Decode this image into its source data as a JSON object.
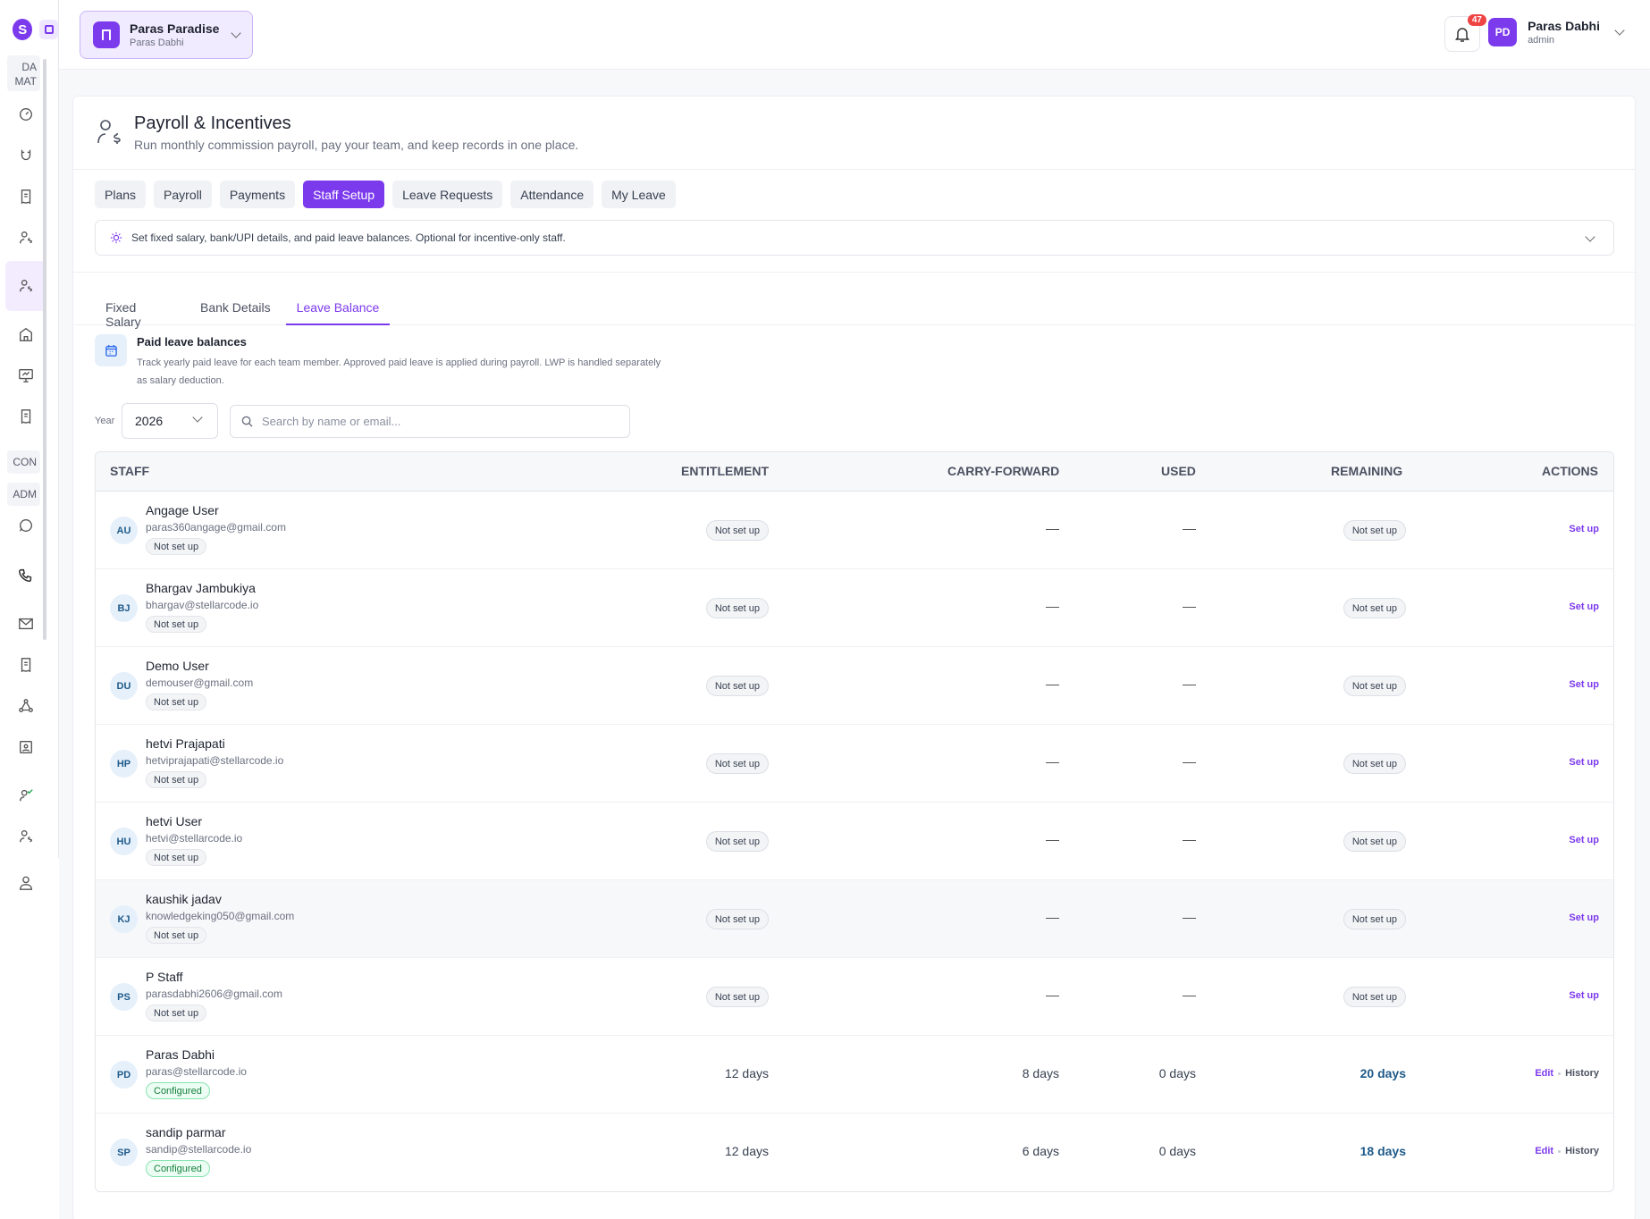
{
  "app": {
    "logo_letter": "S"
  },
  "sidebar": {
    "sections": [
      "DA MAT",
      "CON",
      "ADM"
    ],
    "icons": [
      "dashboard-icon",
      "magnet-icon",
      "receipt-icon",
      "payroll-icon",
      "payroll-active-icon",
      "building-icon",
      "monitor-icon",
      "document-icon",
      "whatsapp-icon",
      "phone-icon",
      "mail-icon",
      "invoice-icon",
      "network-icon",
      "contacts-icon",
      "user-check-icon",
      "user-dollar-icon",
      "profile-icon"
    ]
  },
  "header": {
    "workspace": {
      "name": "Paras Paradise",
      "owner": "Paras Dabhi"
    },
    "notifications": {
      "count": "47"
    },
    "user": {
      "initials": "PD",
      "name": "Paras Dabhi",
      "role": "admin"
    }
  },
  "page": {
    "title": "Payroll & Incentives",
    "subtitle": "Run monthly commission payroll, pay your team, and keep records in one place.",
    "tabs": [
      "Plans",
      "Payroll",
      "Payments",
      "Staff Setup",
      "Leave Requests",
      "Attendance",
      "My Leave"
    ],
    "active_tab": "Staff Setup",
    "hint": "Set fixed salary, bank/UPI details, and paid leave balances. Optional for incentive-only staff.",
    "subtabs": [
      "Fixed Salary",
      "Bank Details",
      "Leave Balance"
    ],
    "active_subtab": "Leave Balance"
  },
  "leave_balance": {
    "title": "Paid leave balances",
    "description": "Track yearly paid leave for each team member. Approved paid leave is applied during payroll. LWP is handled separately as salary deduction.",
    "year_label": "Year",
    "year_value": "2026",
    "search_placeholder": "Search by name or email..."
  },
  "table": {
    "headers": {
      "staff": "STAFF",
      "entitlement": "ENTITLEMENT",
      "carry": "CARRY-FORWARD",
      "used": "USED",
      "remaining": "REMAINING",
      "actions": "ACTIONS"
    },
    "rows": [
      {
        "initials": "AU",
        "name": "Angage User",
        "email": "paras360angage@gmail.com",
        "status": "Not set up",
        "entitlement": "Not set up",
        "carry": "—",
        "used": "—",
        "remaining": "Not set up",
        "action": "Set up"
      },
      {
        "initials": "BJ",
        "name": "Bhargav Jambukiya",
        "email": "bhargav@stellarcode.io",
        "status": "Not set up",
        "entitlement": "Not set up",
        "carry": "—",
        "used": "—",
        "remaining": "Not set up",
        "action": "Set up"
      },
      {
        "initials": "DU",
        "name": "Demo User",
        "email": "demouser@gmail.com",
        "status": "Not set up",
        "entitlement": "Not set up",
        "carry": "—",
        "used": "—",
        "remaining": "Not set up",
        "action": "Set up"
      },
      {
        "initials": "HP",
        "name": "hetvi Prajapati",
        "email": "hetviprajapati@stellarcode.io",
        "status": "Not set up",
        "entitlement": "Not set up",
        "carry": "—",
        "used": "—",
        "remaining": "Not set up",
        "action": "Set up"
      },
      {
        "initials": "HU",
        "name": "hetvi User",
        "email": "hetvi@stellarcode.io",
        "status": "Not set up",
        "entitlement": "Not set up",
        "carry": "—",
        "used": "—",
        "remaining": "Not set up",
        "action": "Set up"
      },
      {
        "initials": "KJ",
        "name": "kaushik jadav",
        "email": "knowledgeking050@gmail.com",
        "status": "Not set up",
        "entitlement": "Not set up",
        "carry": "—",
        "used": "—",
        "remaining": "Not set up",
        "action": "Set up"
      },
      {
        "initials": "PS",
        "name": "P Staff",
        "email": "parasdabhi2606@gmail.com",
        "status": "Not set up",
        "entitlement": "Not set up",
        "carry": "—",
        "used": "—",
        "remaining": "Not set up",
        "action": "Set up"
      },
      {
        "initials": "PD",
        "name": "Paras Dabhi",
        "email": "paras@stellarcode.io",
        "status": "Configured",
        "entitlement": "12 days",
        "carry": "8 days",
        "used": "0 days",
        "remaining": "20 days",
        "action": "Edit",
        "action2": "History"
      },
      {
        "initials": "SP",
        "name": "sandip parmar",
        "email": "sandip@stellarcode.io",
        "status": "Configured",
        "entitlement": "12 days",
        "carry": "6 days",
        "used": "0 days",
        "remaining": "18 days",
        "action": "Edit",
        "action2": "History"
      }
    ]
  },
  "colors": {
    "accent": "#7c3aed",
    "remaining": "#1e5a8a",
    "configured": "#15803d"
  }
}
